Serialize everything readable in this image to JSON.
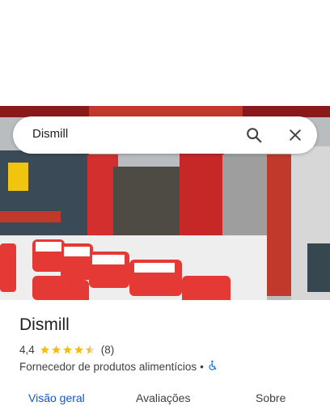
{
  "search": {
    "query": "Dismill"
  },
  "place": {
    "name": "Dismill",
    "rating": "4,4",
    "rating_value": 4.4,
    "review_count": "(8)",
    "category": "Fornecedor de produtos alimentícios",
    "separator": "•",
    "accessibility_icon": "wheelchair-accessible-icon"
  },
  "tabs": [
    {
      "label": "Visão geral",
      "active": true
    },
    {
      "label": "Avaliações",
      "active": false
    },
    {
      "label": "Sobre",
      "active": false
    }
  ],
  "colors": {
    "star": "#fbbc04",
    "accent": "#0b57d0",
    "text": "#202124"
  }
}
